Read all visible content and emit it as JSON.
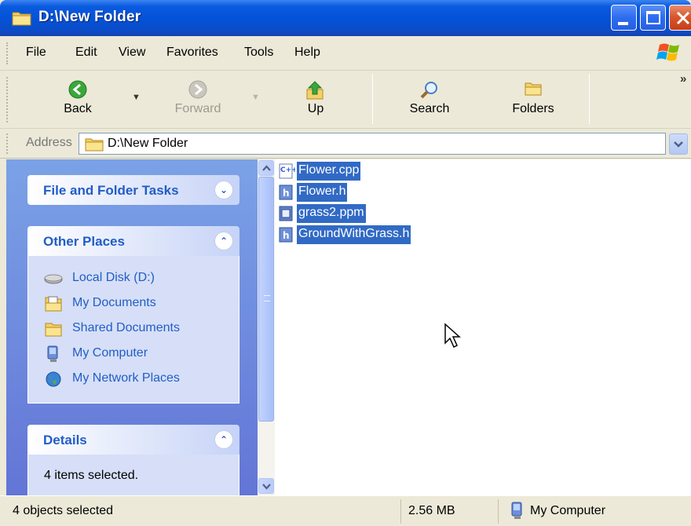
{
  "window": {
    "title": "D:\\New Folder"
  },
  "menu": {
    "items": [
      "File",
      "Edit",
      "View",
      "Favorites",
      "Tools",
      "Help"
    ]
  },
  "toolbar": {
    "back_label": "Back",
    "forward_label": "Forward",
    "up_label": "Up",
    "search_label": "Search",
    "folders_label": "Folders",
    "overflow_glyph": "»"
  },
  "address": {
    "label": "Address",
    "value": "D:\\New Folder"
  },
  "taskpane": {
    "file_tasks": {
      "title": "File and Folder Tasks",
      "toggle": "⌄⌄"
    },
    "other_places": {
      "title": "Other Places",
      "items": [
        {
          "label": "Local Disk (D:)",
          "icon": "hard-drive-icon"
        },
        {
          "label": "My Documents",
          "icon": "my-documents-icon"
        },
        {
          "label": "Shared Documents",
          "icon": "folder-icon"
        },
        {
          "label": "My Computer",
          "icon": "my-computer-icon"
        },
        {
          "label": "My Network Places",
          "icon": "network-places-icon"
        }
      ]
    },
    "details": {
      "title": "Details",
      "text": "4 items selected."
    }
  },
  "files": [
    {
      "name": "Flower.cpp",
      "icon": "cpp-file-icon",
      "selected": true
    },
    {
      "name": "Flower.h",
      "icon": "header-file-icon",
      "selected": true
    },
    {
      "name": "grass2.ppm",
      "icon": "image-file-icon",
      "selected": true
    },
    {
      "name": "GroundWithGrass.h",
      "icon": "header-file-icon",
      "selected": true
    }
  ],
  "status": {
    "selection": "4 objects selected",
    "size": "2.56 MB",
    "zone": "My Computer"
  },
  "colors": {
    "titlebar": "#0451d6",
    "selection": "#316ac5",
    "taskpane_link": "#215dc6",
    "close_button": "#d8532a"
  }
}
